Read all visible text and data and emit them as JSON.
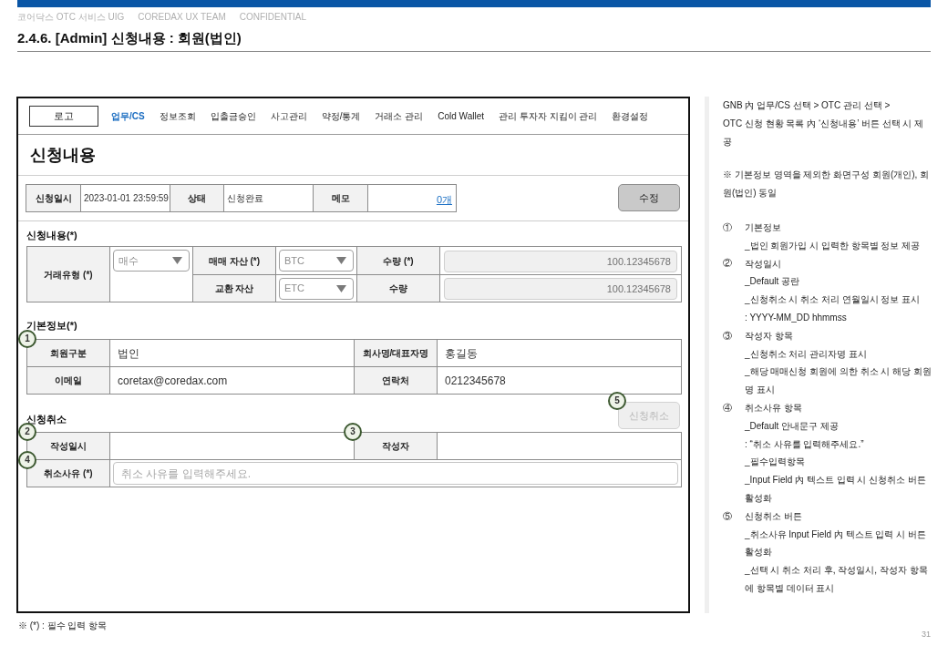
{
  "header": {
    "breadcrumb": [
      "코어닥스 OTC 서비스 UIG",
      "COREDAX UX TEAM",
      "CONFIDENTIAL"
    ],
    "title": "2.4.6. [Admin] 신청내용 : 회원(법인)"
  },
  "screen": {
    "logo": "로고",
    "nav": [
      {
        "label": "업무/CS",
        "selected": true
      },
      {
        "label": "정보조회",
        "selected": false
      },
      {
        "label": "입출금승인",
        "selected": false
      },
      {
        "label": "사고관리",
        "selected": false
      },
      {
        "label": "약정/통계",
        "selected": false
      },
      {
        "label": "거래소 관리",
        "selected": false
      },
      {
        "label": "Cold Wallet",
        "selected": false
      },
      {
        "label": "관리 투자자 지킴이 관리",
        "selected": false
      },
      {
        "label": "환경설정",
        "selected": false
      }
    ],
    "page_title": "신청내용",
    "summary": {
      "fields": [
        {
          "label": "신청일시",
          "value": "2023-01-01 23:59:59",
          "kind": "text"
        },
        {
          "label": "상태",
          "value": "신청완료",
          "kind": "text"
        },
        {
          "label": "메모",
          "value": "0개",
          "kind": "link"
        }
      ],
      "edit_button": {
        "label": "수정",
        "disabled": false
      }
    },
    "request": {
      "title": "신청내용(*)",
      "trade_type": {
        "label": "거래유형 (*)",
        "value": "매수",
        "disabled": true
      },
      "rows": [
        {
          "asset_label": "매매 자산 (*)",
          "asset": {
            "value": "BTC",
            "disabled": true
          },
          "quantity_label": "수량 (*)",
          "quantity": {
            "value": "100.12345678",
            "disabled": true
          }
        },
        {
          "asset_label": "교환 자산",
          "asset": {
            "value": "ETC",
            "disabled": true
          },
          "quantity_label": "수량",
          "quantity": {
            "value": "100.12345678",
            "disabled": true
          }
        }
      ]
    },
    "basic_info": {
      "title": "기본정보(*)",
      "marker": "1",
      "rows": [
        [
          {
            "label": "회원구분",
            "value": "법인"
          },
          {
            "label": "회사명/대표자명",
            "value": "홍길동"
          }
        ],
        [
          {
            "label": "이메일",
            "value": "coretax@coredax.com"
          },
          {
            "label": "연락처",
            "value": "0212345678"
          }
        ]
      ]
    },
    "cancel": {
      "title": "신청취소",
      "button": {
        "label": "신청취소",
        "disabled": true,
        "marker": "5"
      },
      "written_at": {
        "label": "작성일시",
        "marker": "2"
      },
      "writer": {
        "label": "작성자",
        "marker": "3"
      },
      "reason": {
        "label": "취소사유 (*)",
        "placeholder": "취소 사유를 입력해주세요.",
        "marker": "4"
      }
    }
  },
  "notes": {
    "intro": [
      "GNB 內 업무/CS 선택 > OTC 관리 선택 >",
      "OTC 신청 현황 목록 內 ‘신청내용’ 버튼 선택 시 제공"
    ],
    "remark": "※ 기본정보 영역을 제외한 화면구성 회원(개인), 회원(법인) 동일",
    "items": [
      {
        "number": "①",
        "title": "기본정보",
        "lines": [
          "_법인 회원가입 시 입력한 항목별 정보 제공"
        ]
      },
      {
        "number": "②",
        "title": "작성일시",
        "lines": [
          "_Default 공란",
          "_신청취소 시 취소 처리 연월일시 정보 표시",
          ": YYYY-MM_DD hhmmss"
        ]
      },
      {
        "number": "③",
        "title": "작성자 항목",
        "lines": [
          "_신청취소 처리 관리자명 표시",
          "_해당 매매신청 회원에 의한 취소 시 해당 회원명 표시"
        ]
      },
      {
        "number": "④",
        "title": "취소사유 항목",
        "lines": [
          "_Default 안내문구 제공",
          ": “취소 사유를 입력해주세요.”",
          "_필수입력항목",
          "_Input Field 內 텍스트 입력 시 신청취소 버튼 활성화"
        ]
      },
      {
        "number": "⑤",
        "title": "신청취소 버튼",
        "lines": [
          "_취소사유 Input Field 內 텍스트 입력 시 버튼 활성화",
          "_선택 시 취소 처리 후, 작성일시, 작성자 항목에 항목별 데이터 표시"
        ]
      }
    ]
  },
  "footer": {
    "legend": "※ (*) : 필수 입력 항목",
    "page_number": "31"
  }
}
